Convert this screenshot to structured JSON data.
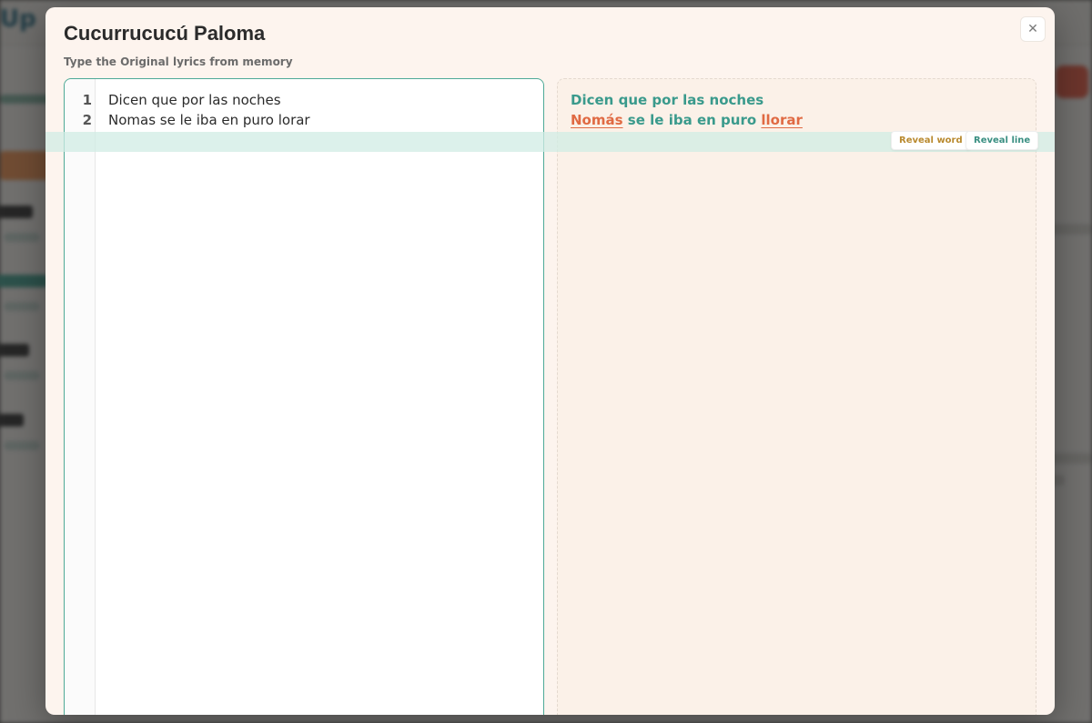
{
  "background": {
    "logo_text": "Up"
  },
  "modal": {
    "title": "Cucurrucucú Paloma",
    "subtitle": "Type the Original lyrics from memory",
    "close_glyph": "✕"
  },
  "editor": {
    "lines": [
      {
        "number": "1",
        "text": "Dicen que por las noches"
      },
      {
        "number": "2",
        "text": "Nomas se le iba en puro lorar"
      }
    ]
  },
  "answer": {
    "lines": [
      {
        "words": [
          {
            "text": "Dicen",
            "status": "correct"
          },
          {
            "text": "que",
            "status": "correct"
          },
          {
            "text": "por",
            "status": "correct"
          },
          {
            "text": "las",
            "status": "correct"
          },
          {
            "text": "noches",
            "status": "correct"
          }
        ]
      },
      {
        "words": [
          {
            "text": "Nomás",
            "status": "wrong"
          },
          {
            "text": "se",
            "status": "correct"
          },
          {
            "text": "le",
            "status": "correct"
          },
          {
            "text": "iba",
            "status": "correct"
          },
          {
            "text": "en",
            "status": "correct"
          },
          {
            "text": "puro",
            "status": "correct"
          },
          {
            "text": "llorar",
            "status": "wrong"
          }
        ]
      }
    ]
  },
  "actions": {
    "reveal_word": "Reveal word",
    "reveal_line": "Reveal line"
  },
  "colors": {
    "correct": "#3a9a8c",
    "wrong": "#e06a43",
    "accent": "#4ea996"
  }
}
